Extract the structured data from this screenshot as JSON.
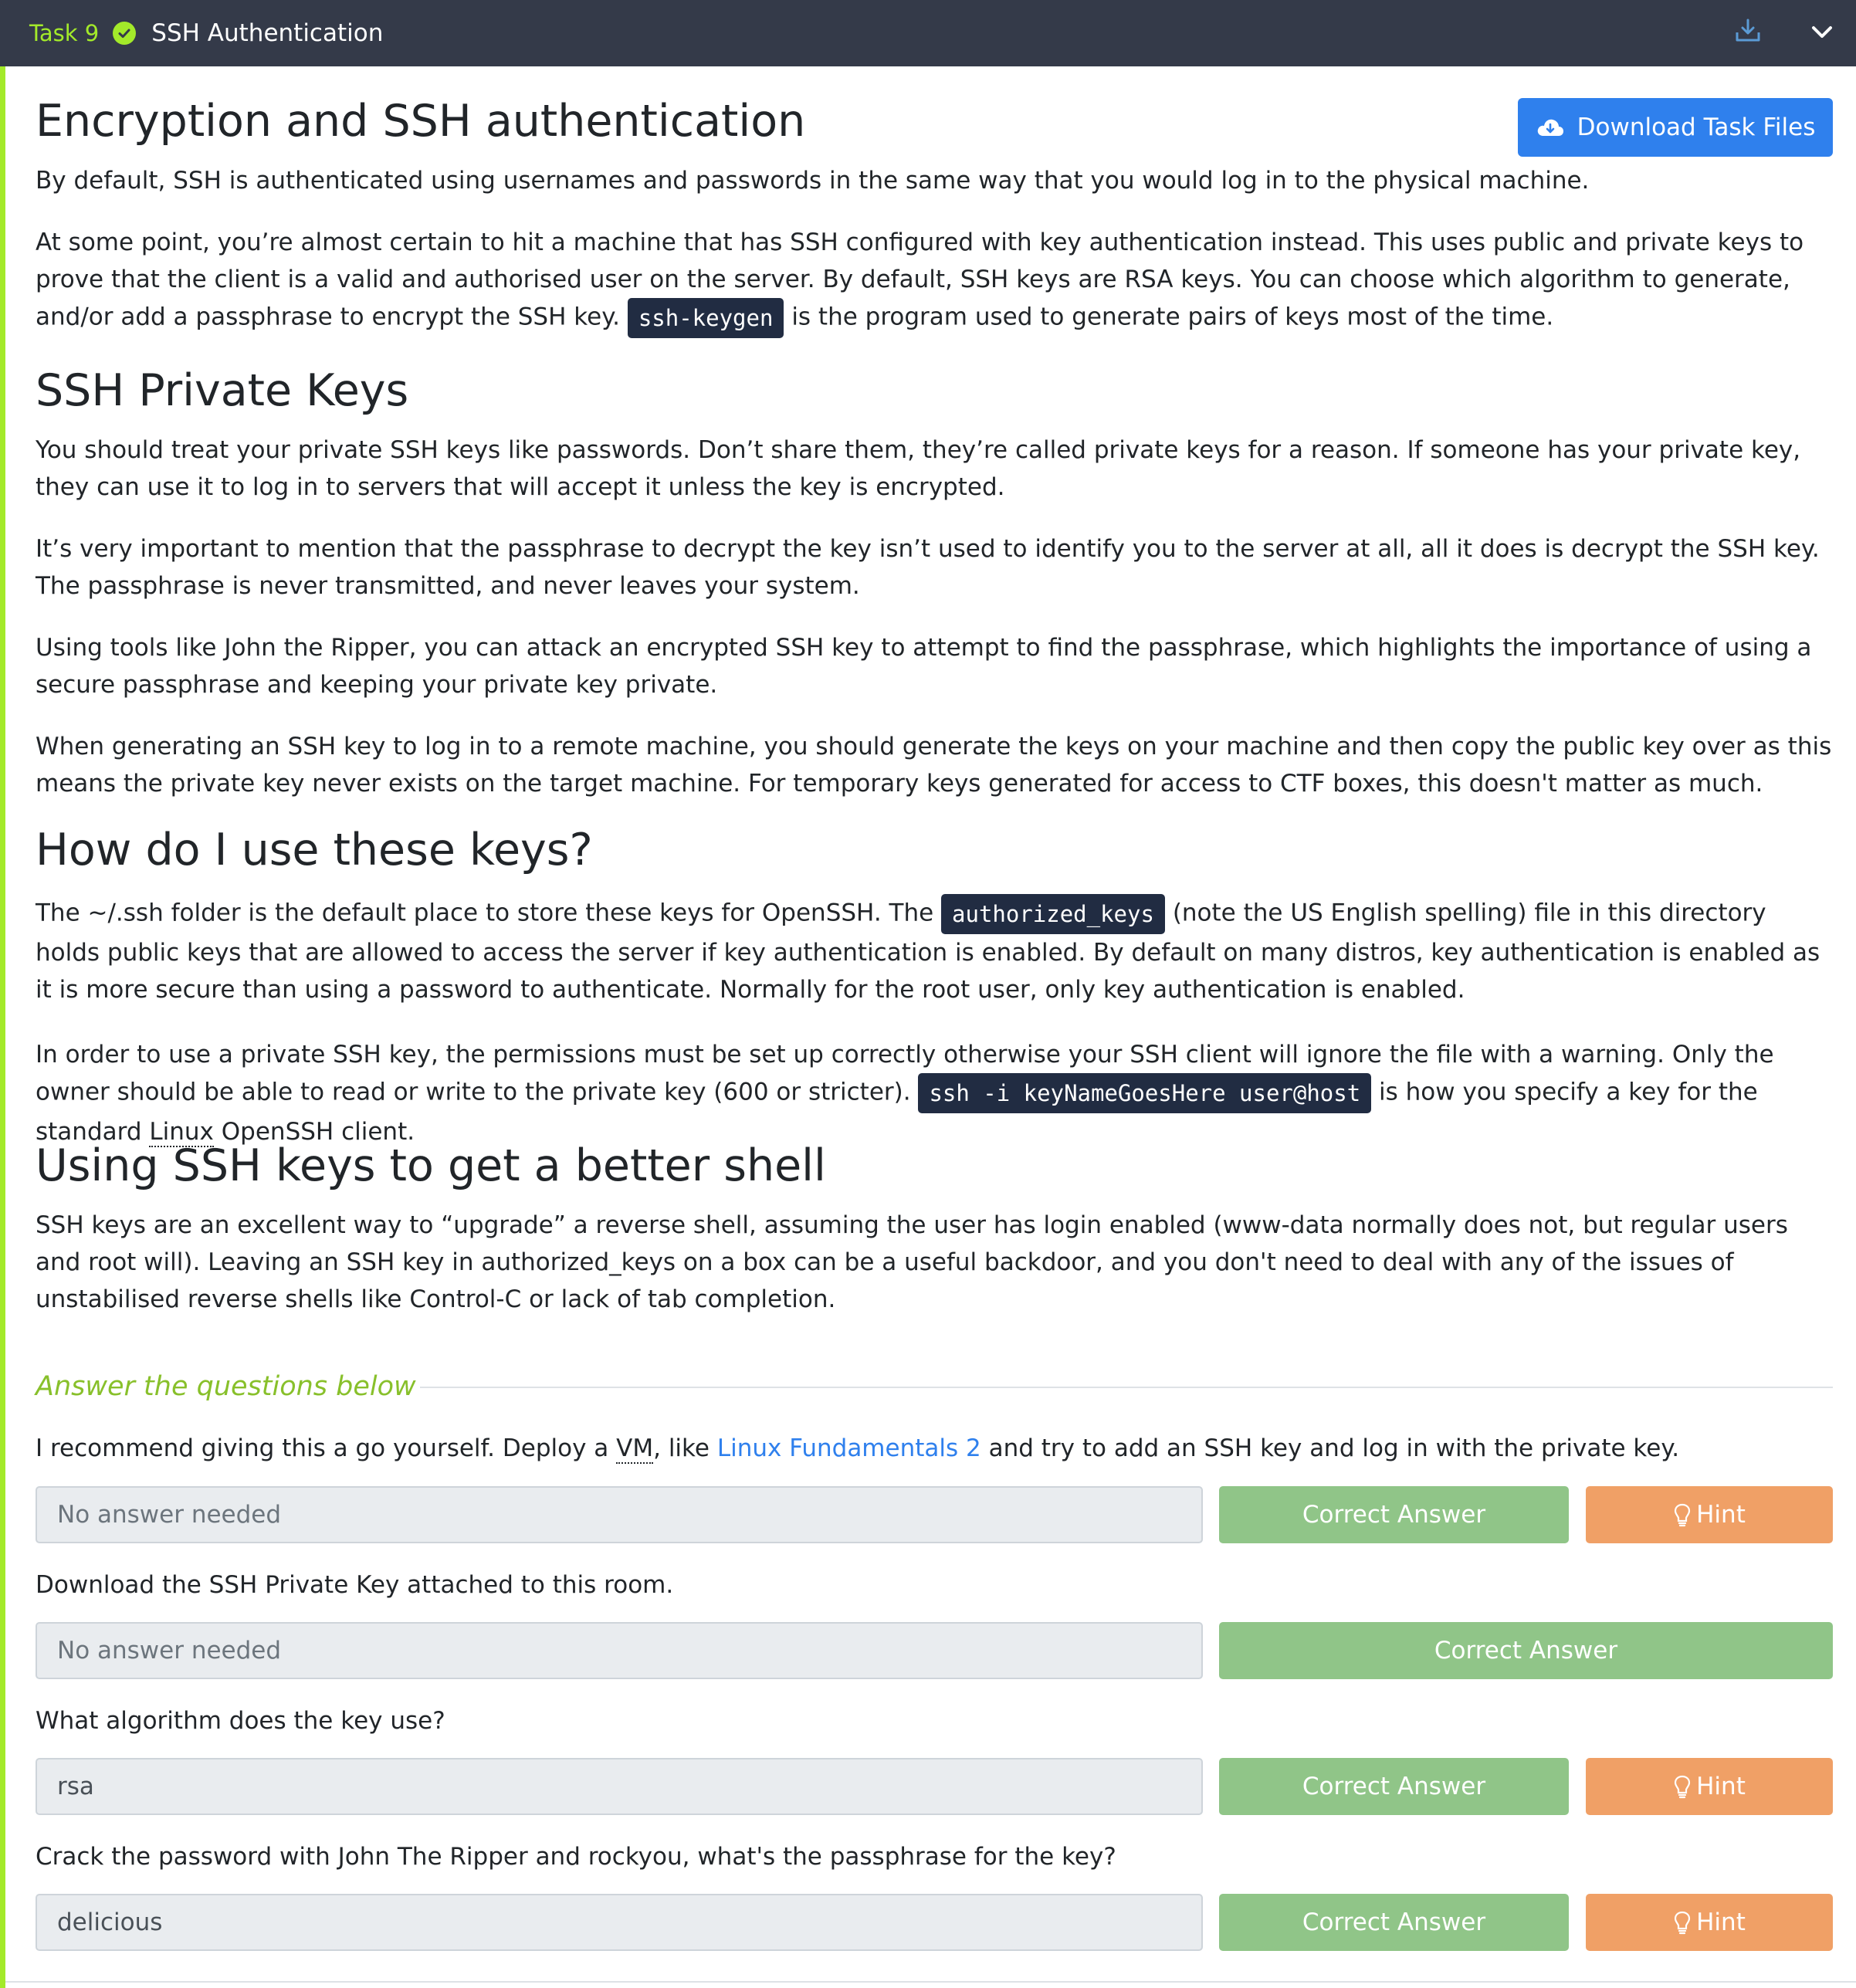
{
  "header": {
    "task_label": "Task 9",
    "title": "SSH Authentication",
    "status": "completed",
    "icons": [
      "check-circle-icon",
      "download-icon",
      "chevron-down-icon"
    ]
  },
  "download_button": {
    "label": "Download Task Files",
    "icon": "cloud-download-icon"
  },
  "sections": {
    "s1": {
      "heading": "Encryption and SSH authentication",
      "p1": "By default, SSH is authenticated using usernames and passwords in the same way that you would log in to the physical machine.",
      "p2_a": "At some point, you’re almost certain to hit a machine that has SSH configured with key authentication instead. This uses public and private keys to prove that the client is a valid and authorised user on the server. By default, SSH keys are RSA keys. You can choose which algorithm to generate, and/or add a passphrase to encrypt the SSH key.",
      "p2_code": "ssh-keygen",
      "p2_b": "is the program used to generate pairs of keys most of the time."
    },
    "s2": {
      "heading": "SSH Private Keys",
      "p1": "You should treat your private SSH keys like passwords. Don’t share them, they’re called private keys for a reason. If someone has your private key, they can use it to log in to servers that will accept it unless the key is encrypted.",
      "p2": "It’s very important to mention that the passphrase to decrypt the key isn’t used to identify you to the server at all, all it does is decrypt the SSH key. The passphrase is never transmitted, and never leaves your system.",
      "p3": "Using tools like John the Ripper, you can attack an encrypted SSH key to attempt to find the passphrase, which highlights the importance of using a secure passphrase and keeping your private key private.",
      "p4": "When generating an SSH key to log in to a remote machine, you should generate the keys on your machine and then copy the public key over as this means the private key never exists on the target machine. For temporary keys generated for access to CTF boxes, this doesn't matter as much."
    },
    "s3": {
      "heading": "How do I use these keys?",
      "p1_a": "The ~/.ssh folder is the default place to store these keys for OpenSSH. The",
      "p1_code": "authorized_keys",
      "p1_b": "(note the US English spelling) file in this directory holds public keys that are allowed to access the server if key authentication is enabled. By default on many distros, key authentication is enabled as it is more secure than using a password to authenticate. Normally for the root user, only key authentication is enabled.",
      "p2_a": "In order to use a private SSH key, the permissions must be set up correctly otherwise your SSH client will ignore the file with a warning. Only the owner should be able to read or write to the private key (600 or stricter).",
      "p2_code": "ssh -i keyNameGoesHere user@host",
      "p2_b": "is how you specify a key for the standard",
      "p2_abbr": "Linux",
      "p2_c": "OpenSSH client."
    },
    "s4": {
      "heading": "Using SSH keys to get a better shell",
      "p1": "SSH keys are an excellent way to “upgrade” a reverse shell, assuming the user has login enabled (www-data normally does not, but regular users and root will). Leaving an SSH key in authorized_keys on a box can be a useful backdoor, and you don't need to deal with any of the issues of unstabilised reverse shells like Control-C or lack of tab completion."
    }
  },
  "questions_heading": "Answer the questions below",
  "questions": [
    {
      "text_a": "I recommend giving this a go yourself. Deploy a",
      "text_abbr": "VM",
      "text_b": ", like",
      "text_link": "Linux Fundamentals 2",
      "text_c": "and try to add an SSH key and log in with the private key.",
      "answer": "No answer needed",
      "correct_label": "Correct Answer",
      "hint_label": "Hint"
    },
    {
      "text": "Download the SSH Private Key attached to this room.",
      "answer": "No answer needed",
      "correct_label": "Correct Answer"
    },
    {
      "text": "What algorithm does the key use?",
      "answer": "rsa",
      "correct_label": "Correct Answer",
      "hint_label": "Hint"
    },
    {
      "text": "Crack the password with John The Ripper and rockyou, what's the passphrase for the key?",
      "answer": "delicious",
      "correct_label": "Correct Answer",
      "hint_label": "Hint"
    }
  ],
  "colors": {
    "header_bg": "#343a49",
    "accent_green": "#a3ea2a",
    "button_blue": "#2f80ed",
    "correct_green": "#90c588",
    "hint_orange": "#f0a066",
    "code_bg": "#212c42"
  }
}
